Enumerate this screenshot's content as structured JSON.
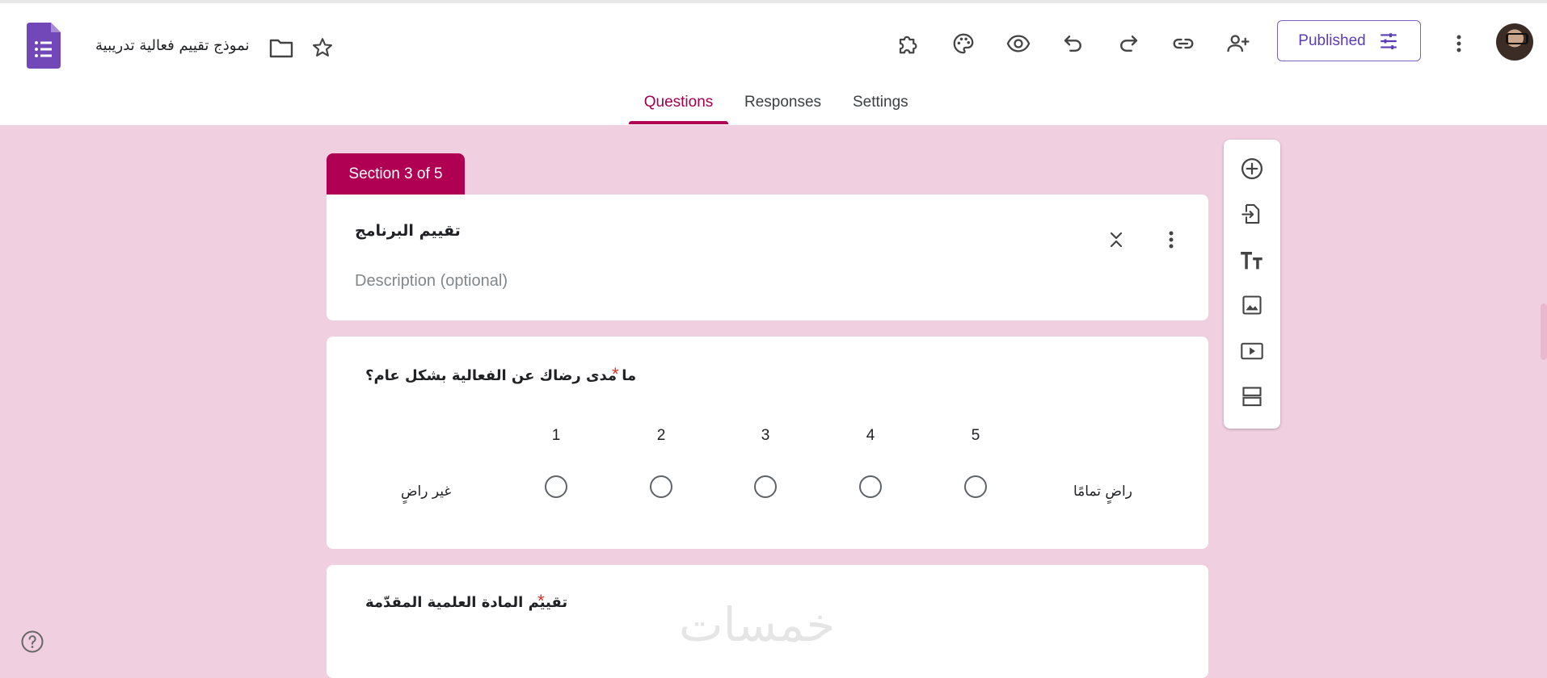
{
  "header": {
    "title": "نموذج تقييم فعالية تدريبية",
    "published_label": "Published",
    "icons": [
      "forms-logo-icon",
      "folder-icon",
      "star-icon",
      "addon-icon",
      "palette-icon",
      "preview-icon",
      "undo-icon",
      "redo-icon",
      "link-icon",
      "add-collaborator-icon",
      "tune-icon",
      "more-vert-icon"
    ]
  },
  "tabs": [
    {
      "label": "Questions",
      "active": true
    },
    {
      "label": "Responses",
      "active": false
    },
    {
      "label": "Settings",
      "active": false
    }
  ],
  "section": {
    "badge": "Section 3 of 5",
    "title": "تقييم البرنامج",
    "description_placeholder": "Description (optional)"
  },
  "questions": [
    {
      "title": "ما مدى رضاك عن الفعالية بشكل عام؟",
      "required_mark": "*",
      "scale": [
        "1",
        "2",
        "3",
        "4",
        "5"
      ],
      "min_label": "غير راضٍ",
      "max_label": "راضٍ تمامًا"
    },
    {
      "title": "تقييم المادة العلمية المقدّمة",
      "required_mark": "*"
    }
  ],
  "watermark": "خمسات",
  "colors": {
    "accent": "#b00054",
    "background": "#f0cfe0",
    "forms_purple": "#7248b9",
    "published": "#5b3db8"
  }
}
